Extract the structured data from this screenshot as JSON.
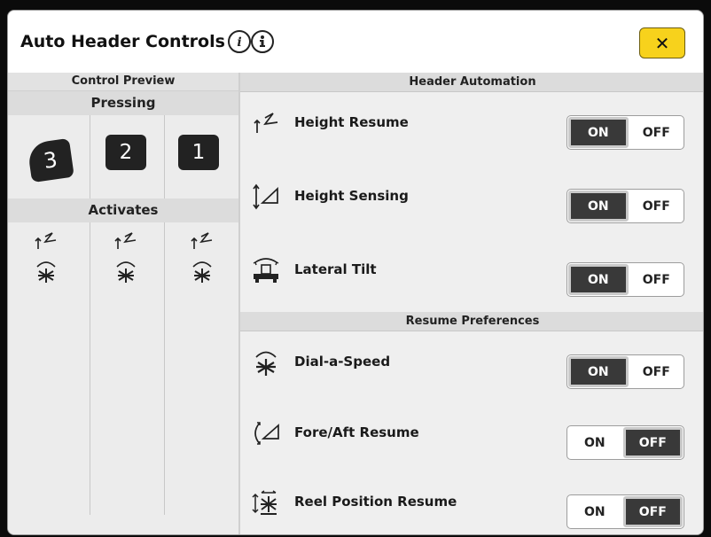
{
  "window": {
    "title": "Auto Header Controls",
    "close_label": "✕"
  },
  "control_preview": {
    "header": "Control Preview",
    "pressing_label": "Pressing",
    "activates_label": "Activates",
    "buttons": [
      "3",
      "2",
      "1"
    ]
  },
  "header_automation": {
    "header": "Header Automation",
    "rows": [
      {
        "label": "Height Resume",
        "icon": "height-resume-icon",
        "on": "ON",
        "off": "OFF",
        "state": "on"
      },
      {
        "label": "Height Sensing",
        "icon": "height-sensing-icon",
        "on": "ON",
        "off": "OFF",
        "state": "on"
      },
      {
        "label": "Lateral Tilt",
        "icon": "lateral-tilt-icon",
        "on": "ON",
        "off": "OFF",
        "state": "on"
      }
    ]
  },
  "resume_preferences": {
    "header": "Resume Preferences",
    "rows": [
      {
        "label": "Dial-a-Speed",
        "icon": "dial-a-speed-icon",
        "on": "ON",
        "off": "OFF",
        "state": "on"
      },
      {
        "label": "Fore/Aft Resume",
        "icon": "fore-aft-resume-icon",
        "on": "ON",
        "off": "OFF",
        "state": "off"
      },
      {
        "label": "Reel Position Resume",
        "icon": "reel-position-resume-icon",
        "on": "ON",
        "off": "OFF",
        "state": "off"
      }
    ]
  },
  "colors": {
    "close_button": "#f7d21c",
    "selected_segment": "#393939",
    "panel_background": "#efefef"
  }
}
